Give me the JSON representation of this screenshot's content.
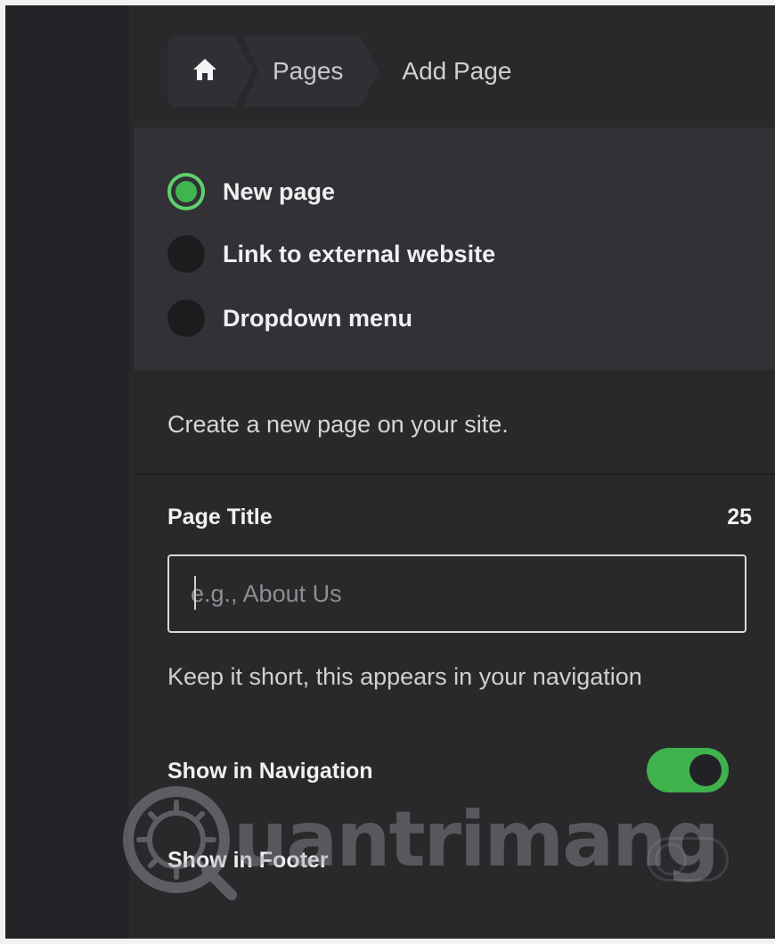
{
  "breadcrumb": {
    "home_icon": "home-icon",
    "pages_label": "Pages",
    "current_label": "Add Page"
  },
  "page_type": {
    "options": [
      {
        "label": "New page",
        "selected": true
      },
      {
        "label": "Link to external website",
        "selected": false
      },
      {
        "label": "Dropdown menu",
        "selected": false
      }
    ]
  },
  "description": "Create a new page on your site.",
  "form": {
    "title_label": "Page Title",
    "char_count": "25",
    "title_placeholder": "e.g., About Us",
    "title_value": "",
    "hint": "Keep it short, this appears in your navigation",
    "show_in_navigation_label": "Show in Navigation",
    "show_in_navigation": true,
    "show_in_footer_label": "Show in Footer",
    "show_in_footer": false
  },
  "colors": {
    "accent_green": "#3fb24c",
    "background": "#29292c",
    "panel": "#323236"
  },
  "watermark": {
    "text": "uantrimang",
    "logo": "quantrimang-logo"
  }
}
